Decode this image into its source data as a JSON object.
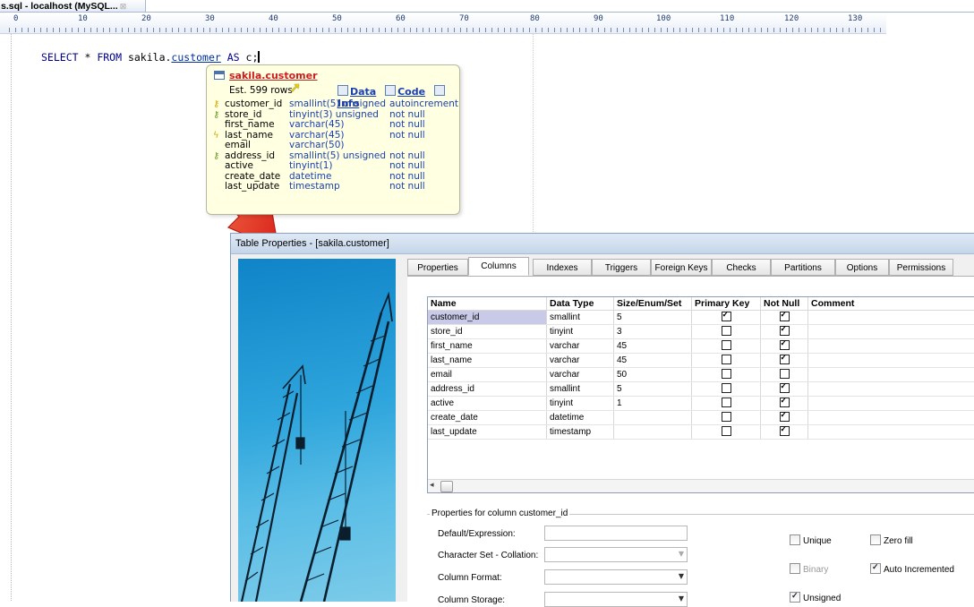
{
  "editor": {
    "tab_title": "s.sql - localhost (MySQL...",
    "tab_close": "⊠",
    "ruler": [
      "0",
      "10",
      "20",
      "30",
      "40",
      "50",
      "60",
      "70",
      "80",
      "90",
      "100",
      "110",
      "120",
      "130"
    ],
    "sql_parts": {
      "select": "SELECT",
      "star": " * ",
      "from": "FROM",
      "table_prefix": " sakila.",
      "table": "customer",
      "as": " AS ",
      "alias": "c;"
    }
  },
  "tooltip": {
    "table_name": "sakila.customer",
    "est_rows": "Est. 599 rows",
    "links": {
      "data": "Data",
      "code": "Code",
      "info": "Info"
    },
    "columns": [
      {
        "name": "customer_id",
        "type": "smallint(5) unsigned",
        "extra": "autoincrement",
        "key": "pk"
      },
      {
        "name": "store_id",
        "type": "tinyint(3) unsigned",
        "extra": "not null",
        "key": "fk"
      },
      {
        "name": "first_name",
        "type": "varchar(45)",
        "extra": "not null",
        "key": ""
      },
      {
        "name": "last_name",
        "type": "varchar(45)",
        "extra": "not null",
        "key": "idx"
      },
      {
        "name": "email",
        "type": "varchar(50)",
        "extra": "",
        "key": ""
      },
      {
        "name": "address_id",
        "type": "smallint(5) unsigned",
        "extra": "not null",
        "key": "fk"
      },
      {
        "name": "active",
        "type": "tinyint(1)",
        "extra": "not null",
        "key": ""
      },
      {
        "name": "create_date",
        "type": "datetime",
        "extra": "not null",
        "key": ""
      },
      {
        "name": "last_update",
        "type": "timestamp",
        "extra": "not null",
        "key": ""
      }
    ]
  },
  "dialog": {
    "title": "Table Properties - [sakila.customer]",
    "tabs": [
      "Properties",
      "Columns",
      "Indexes",
      "Triggers",
      "Foreign Keys",
      "Checks",
      "Partitions",
      "Options",
      "Permissions"
    ],
    "active_tab": "Columns",
    "grid": {
      "headers": [
        "Name",
        "Data Type",
        "Size/Enum/Set",
        "Primary Key",
        "Not Null",
        "Comment"
      ],
      "rows": [
        {
          "name": "customer_id",
          "type": "smallint",
          "size": "5",
          "pk": true,
          "nn": true
        },
        {
          "name": "store_id",
          "type": "tinyint",
          "size": "3",
          "pk": false,
          "nn": true
        },
        {
          "name": "first_name",
          "type": "varchar",
          "size": "45",
          "pk": false,
          "nn": true
        },
        {
          "name": "last_name",
          "type": "varchar",
          "size": "45",
          "pk": false,
          "nn": true
        },
        {
          "name": "email",
          "type": "varchar",
          "size": "50",
          "pk": false,
          "nn": false
        },
        {
          "name": "address_id",
          "type": "smallint",
          "size": "5",
          "pk": false,
          "nn": true
        },
        {
          "name": "active",
          "type": "tinyint",
          "size": "1",
          "pk": false,
          "nn": true
        },
        {
          "name": "create_date",
          "type": "datetime",
          "size": "",
          "pk": false,
          "nn": true
        },
        {
          "name": "last_update",
          "type": "timestamp",
          "size": "",
          "pk": false,
          "nn": true
        }
      ]
    },
    "props": {
      "legend": "Properties for column customer_id",
      "default_label": "Default/Expression:",
      "charset_label": "Character Set - Collation:",
      "format_label": "Column Format:",
      "storage_label": "Column Storage:",
      "unique": "Unique",
      "zerofill": "Zero fill",
      "binary": "Binary",
      "auto_incremented": "Auto Incremented",
      "unsigned": "Unsigned"
    }
  }
}
